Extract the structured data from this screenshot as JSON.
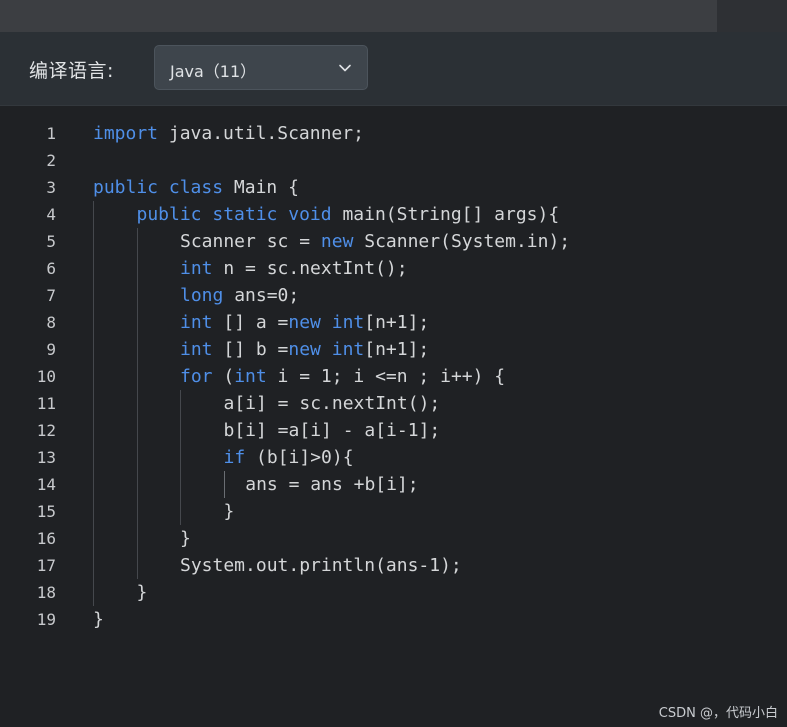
{
  "toolbar": {
    "language_label": "编译语言:",
    "language_value": "Java（11）",
    "dropdown_icon": "chevron-down-icon"
  },
  "editor": {
    "lines": [
      {
        "number": "1",
        "indent": 0,
        "tokens": [
          {
            "t": "import",
            "c": "kw"
          },
          {
            "t": " java.util.Scanner;"
          }
        ]
      },
      {
        "number": "2",
        "indent": 0,
        "tokens": []
      },
      {
        "number": "3",
        "indent": 0,
        "tokens": [
          {
            "t": "public",
            "c": "kw"
          },
          {
            "t": " "
          },
          {
            "t": "class",
            "c": "kw"
          },
          {
            "t": " Main {"
          }
        ]
      },
      {
        "number": "4",
        "indent": 1,
        "tokens": [
          {
            "t": "public",
            "c": "kw"
          },
          {
            "t": " "
          },
          {
            "t": "static",
            "c": "kw"
          },
          {
            "t": " "
          },
          {
            "t": "void",
            "c": "kw"
          },
          {
            "t": " main(String[] args){"
          }
        ]
      },
      {
        "number": "5",
        "indent": 2,
        "tokens": [
          {
            "t": "Scanner sc = "
          },
          {
            "t": "new",
            "c": "kw"
          },
          {
            "t": " Scanner(System.in);"
          }
        ]
      },
      {
        "number": "6",
        "indent": 2,
        "tokens": [
          {
            "t": "int",
            "c": "ty"
          },
          {
            "t": " n = sc.nextInt();"
          }
        ]
      },
      {
        "number": "7",
        "indent": 2,
        "tokens": [
          {
            "t": "long",
            "c": "ty"
          },
          {
            "t": " ans=0;"
          }
        ]
      },
      {
        "number": "8",
        "indent": 2,
        "tokens": [
          {
            "t": "int",
            "c": "ty"
          },
          {
            "t": " [] a ="
          },
          {
            "t": "new",
            "c": "kw"
          },
          {
            "t": " "
          },
          {
            "t": "int",
            "c": "ty"
          },
          {
            "t": "[n+1];"
          }
        ]
      },
      {
        "number": "9",
        "indent": 2,
        "tokens": [
          {
            "t": "int",
            "c": "ty"
          },
          {
            "t": " [] b ="
          },
          {
            "t": "new",
            "c": "kw"
          },
          {
            "t": " "
          },
          {
            "t": "int",
            "c": "ty"
          },
          {
            "t": "[n+1];"
          }
        ]
      },
      {
        "number": "10",
        "indent": 2,
        "tokens": [
          {
            "t": "for",
            "c": "kw"
          },
          {
            "t": " ("
          },
          {
            "t": "int",
            "c": "ty"
          },
          {
            "t": " i = 1; i <=n ; i++) {"
          }
        ]
      },
      {
        "number": "11",
        "indent": 3,
        "tokens": [
          {
            "t": "a[i] = sc.nextInt();"
          }
        ]
      },
      {
        "number": "12",
        "indent": 3,
        "tokens": [
          {
            "t": "b[i] =a[i] - a[i-1];"
          }
        ]
      },
      {
        "number": "13",
        "indent": 3,
        "tokens": [
          {
            "t": "if",
            "c": "kw"
          },
          {
            "t": " (b[i]>0){"
          }
        ]
      },
      {
        "number": "14",
        "indent": 3.5,
        "tokens": [
          {
            "t": "ans = ans +b[i];"
          }
        ]
      },
      {
        "number": "15",
        "indent": 3,
        "tokens": [
          {
            "t": "}"
          }
        ]
      },
      {
        "number": "16",
        "indent": 2,
        "tokens": [
          {
            "t": "}"
          }
        ]
      },
      {
        "number": "17",
        "indent": 2,
        "tokens": [
          {
            "t": "System.out.println(ans-1);"
          }
        ]
      },
      {
        "number": "18",
        "indent": 1,
        "tokens": [
          {
            "t": "}"
          }
        ]
      },
      {
        "number": "19",
        "indent": 0,
        "tokens": [
          {
            "t": "}"
          }
        ]
      }
    ]
  },
  "watermark": "CSDN @，代码小白",
  "colors": {
    "keyword": "#4f8fe8",
    "code_text": "#d4d6d8",
    "line_number": "#c7c9cc",
    "editor_background": "#1f2124",
    "toolbar_background": "#2b3035"
  }
}
